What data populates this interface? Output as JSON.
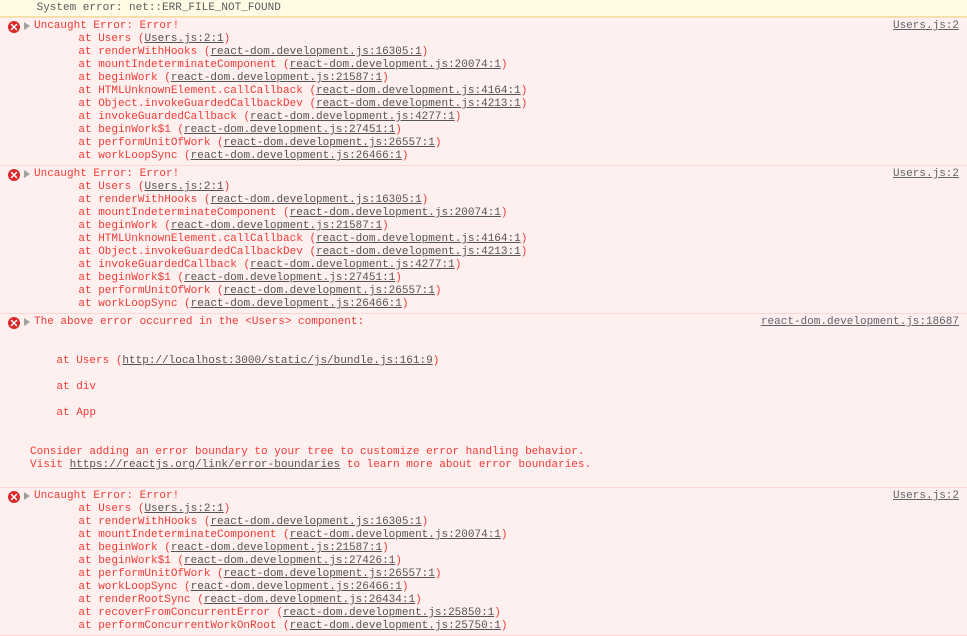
{
  "sys_error": " System error: net::ERR_FILE_NOT_FOUND",
  "source_users": "Users.js:2",
  "source_react": "react-dom.development.js:18687",
  "err_title": "Uncaught Error: Error!",
  "stack_a": [
    {
      "fn": "Users",
      "loc": "Users.js:2:1"
    },
    {
      "fn": "renderWithHooks",
      "loc": "react-dom.development.js:16305:1"
    },
    {
      "fn": "mountIndeterminateComponent",
      "loc": "react-dom.development.js:20074:1"
    },
    {
      "fn": "beginWork",
      "loc": "react-dom.development.js:21587:1"
    },
    {
      "fn": "HTMLUnknownElement.callCallback",
      "loc": "react-dom.development.js:4164:1"
    },
    {
      "fn": "Object.invokeGuardedCallbackDev",
      "loc": "react-dom.development.js:4213:1"
    },
    {
      "fn": "invokeGuardedCallback",
      "loc": "react-dom.development.js:4277:1"
    },
    {
      "fn": "beginWork$1",
      "loc": "react-dom.development.js:27451:1"
    },
    {
      "fn": "performUnitOfWork",
      "loc": "react-dom.development.js:26557:1"
    },
    {
      "fn": "workLoopSync",
      "loc": "react-dom.development.js:26466:1"
    }
  ],
  "component_err": {
    "header": "The above error occurred in the <Users> component:",
    "users_line_prefix": "at Users (",
    "users_link": "http://localhost:3000/static/js/bundle.js:161:9",
    "div_line": "at div",
    "app_line": "at App",
    "advice1": "Consider adding an error boundary to your tree to customize error handling behavior.",
    "advice2a": "Visit ",
    "advice2link": "https://reactjs.org/link/error-boundaries",
    "advice2b": " to learn more about error boundaries."
  },
  "stack_d": [
    {
      "fn": "Users",
      "loc": "Users.js:2:1"
    },
    {
      "fn": "renderWithHooks",
      "loc": "react-dom.development.js:16305:1"
    },
    {
      "fn": "mountIndeterminateComponent",
      "loc": "react-dom.development.js:20074:1"
    },
    {
      "fn": "beginWork",
      "loc": "react-dom.development.js:21587:1"
    },
    {
      "fn": "beginWork$1",
      "loc": "react-dom.development.js:27426:1"
    },
    {
      "fn": "performUnitOfWork",
      "loc": "react-dom.development.js:26557:1"
    },
    {
      "fn": "workLoopSync",
      "loc": "react-dom.development.js:26466:1"
    },
    {
      "fn": "renderRootSync",
      "loc": "react-dom.development.js:26434:1"
    },
    {
      "fn": "recoverFromConcurrentError",
      "loc": "react-dom.development.js:25850:1"
    },
    {
      "fn": "performConcurrentWorkOnRoot",
      "loc": "react-dom.development.js:25750:1"
    }
  ]
}
